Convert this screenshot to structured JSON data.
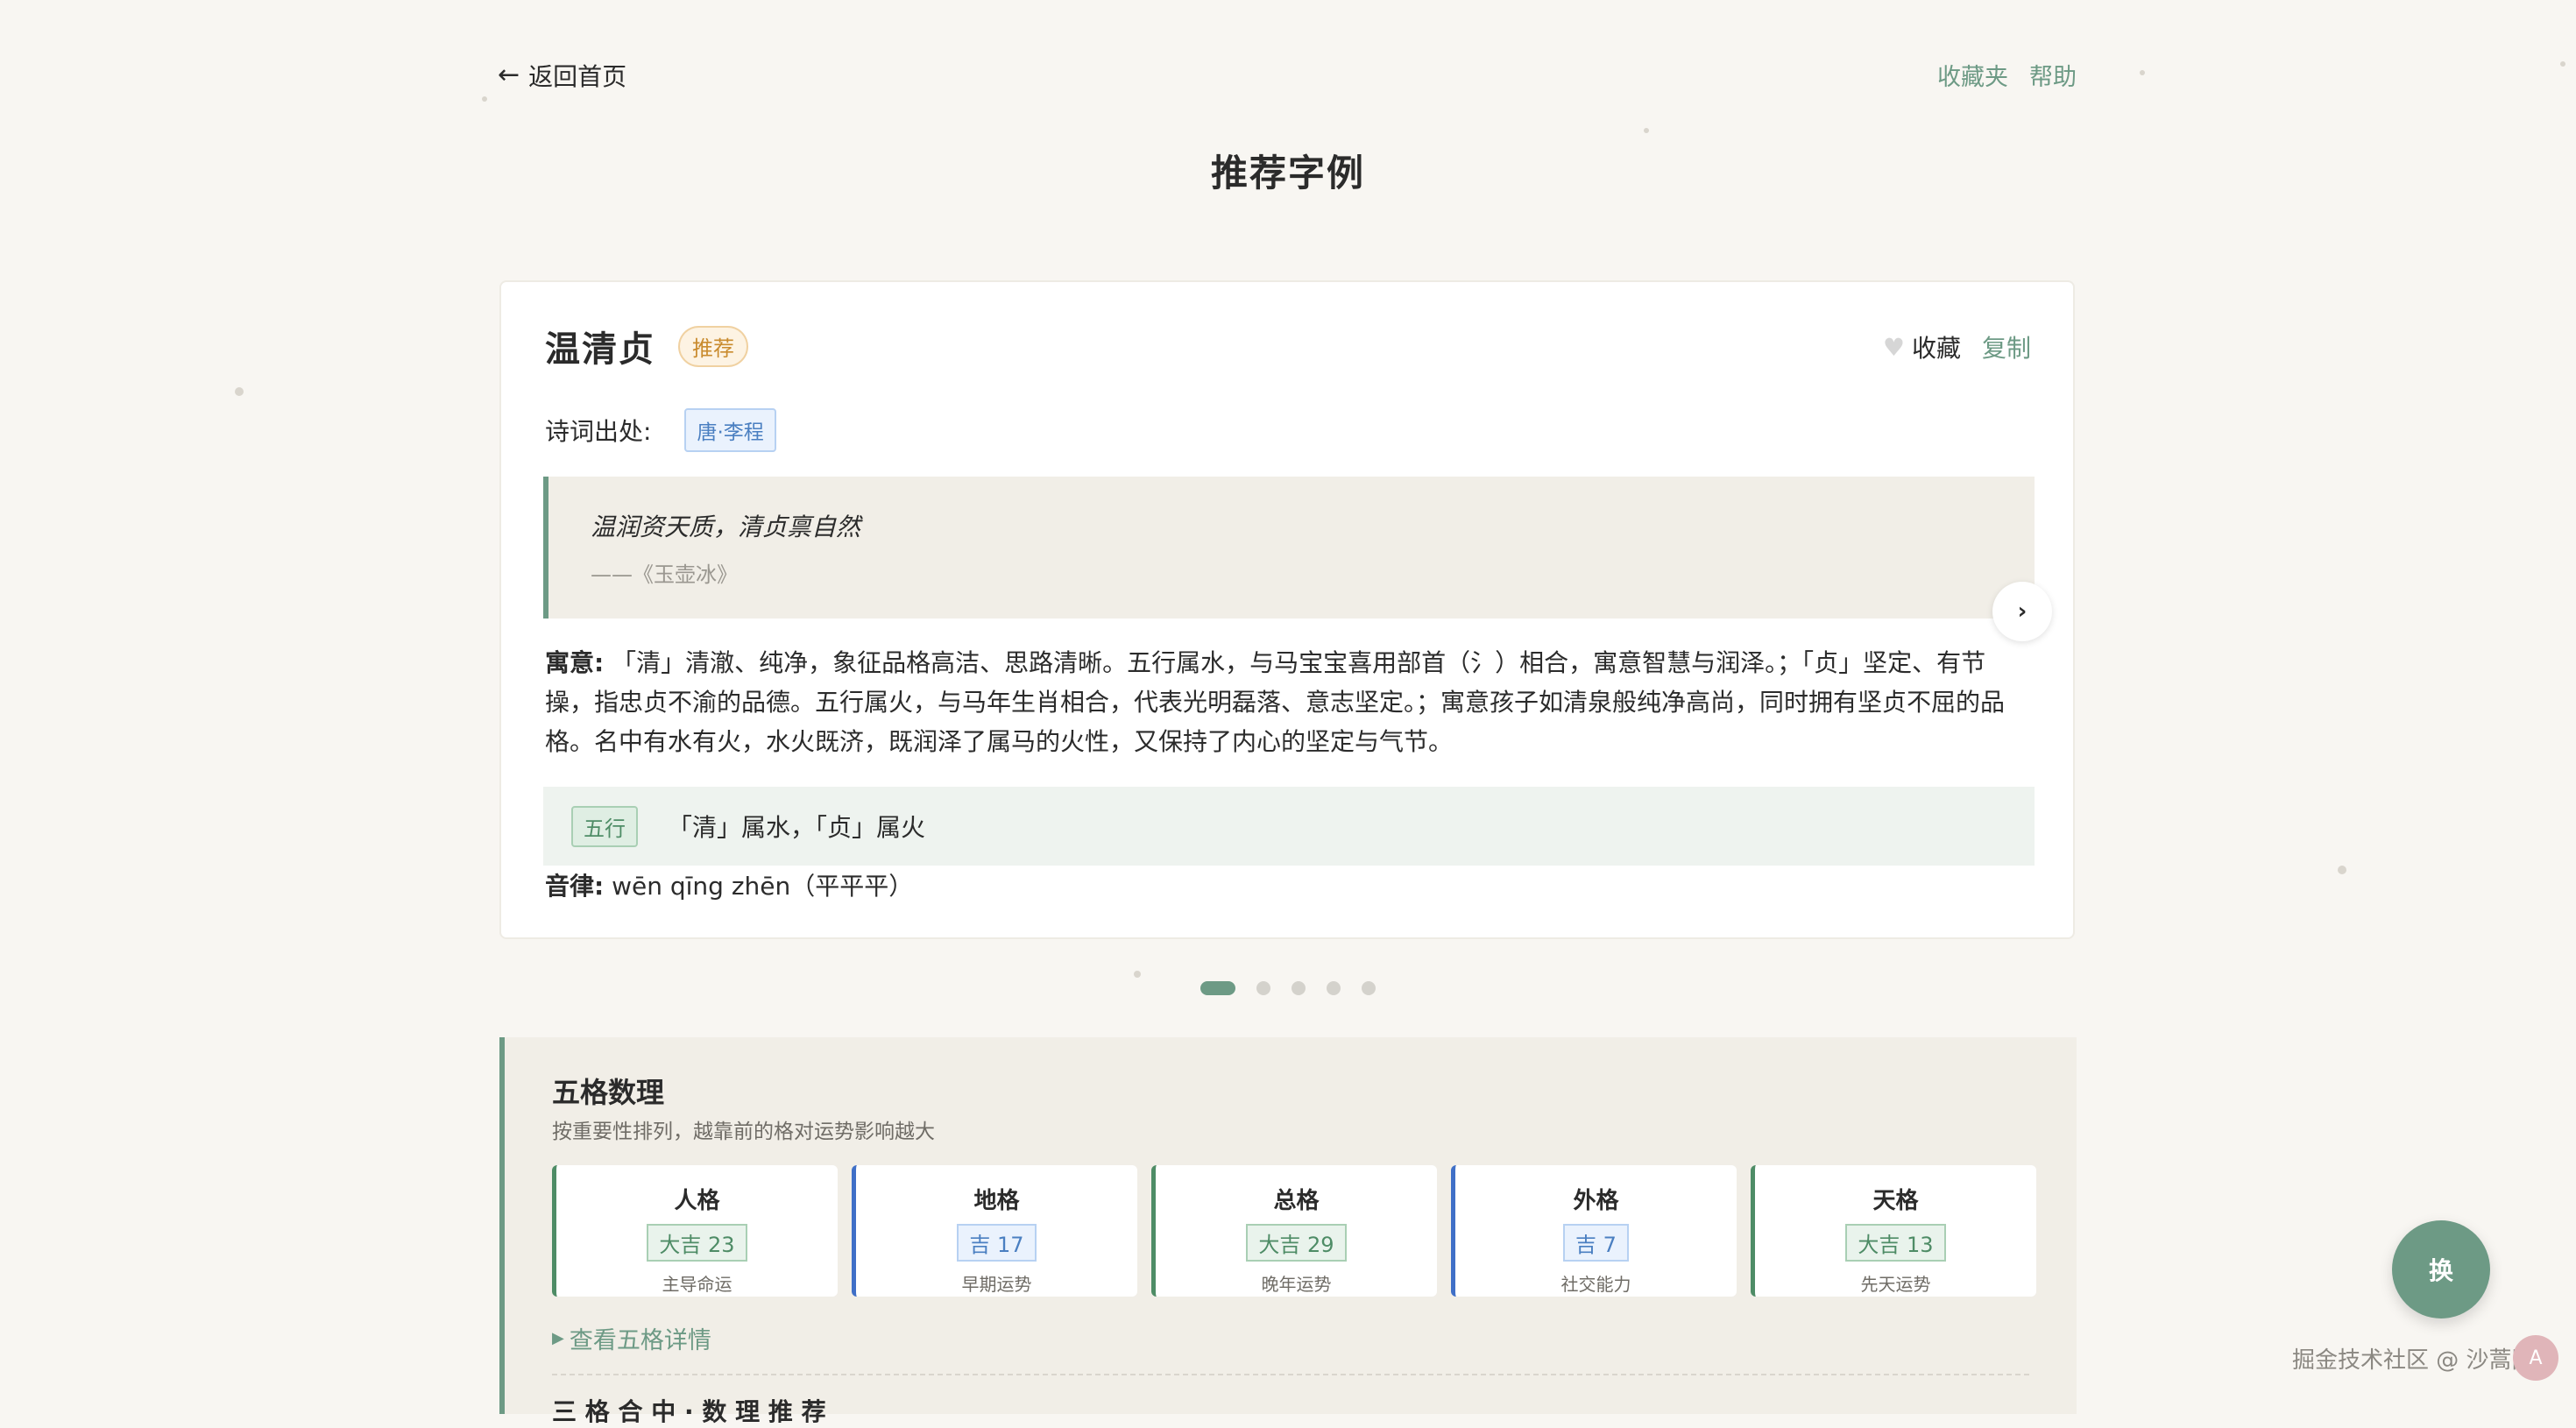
{
  "nav": {
    "back_label": "返回首页",
    "favorites": "收藏夹",
    "help": "帮助"
  },
  "page_title": "推荐字例",
  "card": {
    "name": "温清贞",
    "badge": "推荐",
    "fav_label": "收藏",
    "copy_label": "复制",
    "source_label": "诗词出处:",
    "source_tag": "唐·李程",
    "poem_line": "温润资天质，清贞禀自然",
    "poem_source": "——《玉壶冰》",
    "meaning_label": "寓意:",
    "meaning_text": "「清」清澈、纯净，象征品格高洁、思路清晰。五行属水，与马宝宝喜用部首（氵）相合，寓意智慧与润泽。；「贞」坚定、有节操，指忠贞不渝的品德。五行属火，与马年生肖相合，代表光明磊落、意志坚定。；寓意孩子如清泉般纯净高尚，同时拥有坚贞不屈的品格。名中有水有火，水火既济，既润泽了属马的火性，又保持了内心的坚定与气节。",
    "wuxing_tag": "五行",
    "wuxing_text": "「清」属水，「贞」属火",
    "yinlv_label": "音律:",
    "yinlv_text": "wēn qīng zhēn（平平平）",
    "carousel_index": 1,
    "carousel_total": 5
  },
  "wuge": {
    "title": "五格数理",
    "subtitle": "按重要性排列，越靠前的格对运势影响越大",
    "grids": [
      {
        "name": "人格",
        "score": "大吉 23",
        "desc": "主导命运",
        "tone": "green"
      },
      {
        "name": "地格",
        "score": "吉 17",
        "desc": "早期运势",
        "tone": "blue"
      },
      {
        "name": "总格",
        "score": "大吉 29",
        "desc": "晚年运势",
        "tone": "green"
      },
      {
        "name": "外格",
        "score": "吉 7",
        "desc": "社交能力",
        "tone": "blue"
      },
      {
        "name": "天格",
        "score": "大吉 13",
        "desc": "先天运势",
        "tone": "green"
      }
    ],
    "more_label": "查看五格详情",
    "cut_title": "三 格 合 中 · 数 理 推 荐"
  },
  "fab_label": "换",
  "watermark": "掘金技术社区 @ 沙蒿同学",
  "watermark_avatar": "A",
  "colors": {
    "accent": "#6d9a85",
    "blue": "#4a7fc1",
    "orange": "#c98b2e"
  }
}
